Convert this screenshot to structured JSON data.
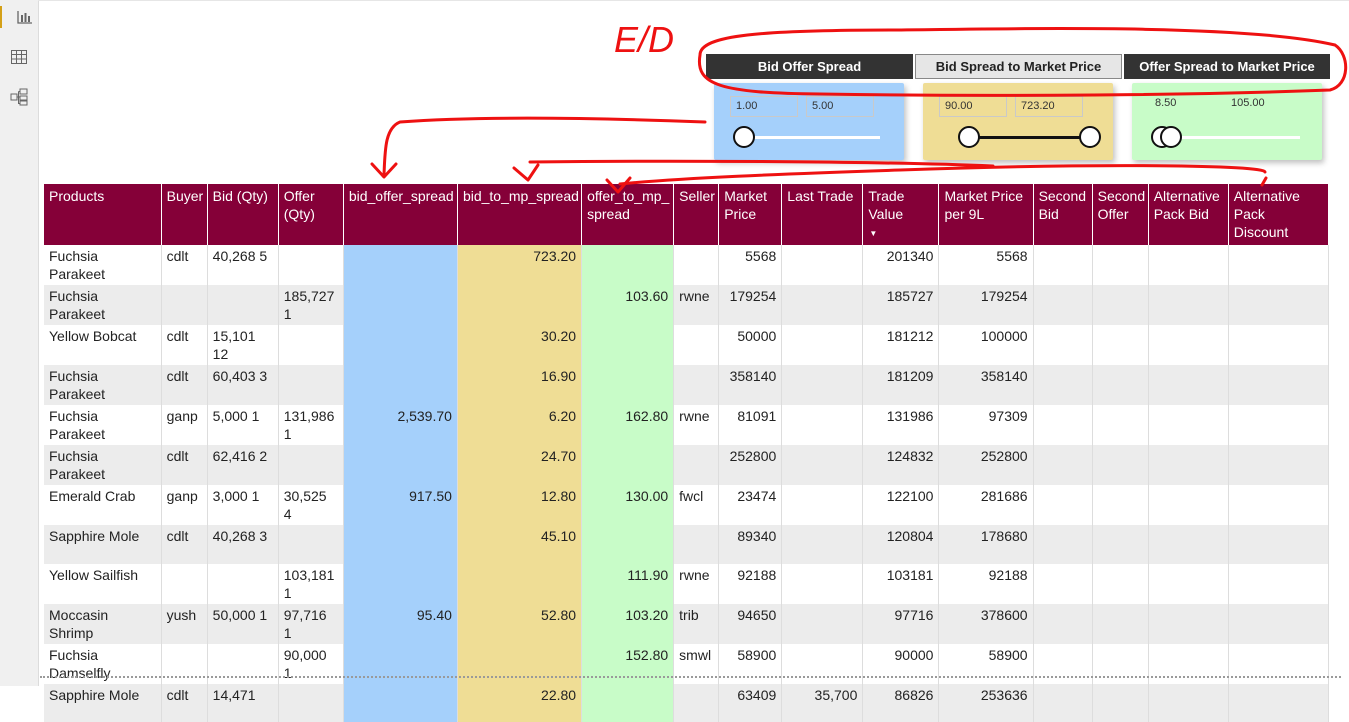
{
  "nav": {
    "items": [
      {
        "name": "report-view-icon"
      },
      {
        "name": "data-view-icon"
      },
      {
        "name": "model-view-icon"
      }
    ]
  },
  "annotation": {
    "text": "E/D"
  },
  "buttons": [
    {
      "label": "Bid Offer Spread",
      "style": "dark"
    },
    {
      "label": "Bid Spread to Market Price",
      "style": "light"
    },
    {
      "label": "Offer Spread to Market Price",
      "style": "dark"
    }
  ],
  "slicers": [
    {
      "min": "1.00",
      "max": "5.00",
      "color": "#a5d0fb"
    },
    {
      "min": "90.00",
      "max": "723.20",
      "color": "#efdd95"
    },
    {
      "min": "8.50",
      "max": "105.00",
      "color": "#c8fcc8"
    }
  ],
  "table": {
    "columns": [
      "Products",
      "Buyer",
      "Bid (Qty)",
      "Offer (Qty)",
      "bid_offer_spread",
      "bid_to_mp_spread",
      "offer_to_mp_ spread",
      "Seller",
      "Market Price",
      "Last Trade",
      "Trade Value",
      "Market Price per 9L",
      "Second Bid",
      "Second Offer",
      "Alternative Pack Bid",
      "Alternative Pack Discount"
    ],
    "sort_column": "Trade Value",
    "rows": [
      [
        "Fuchsia Parakeet",
        "cdlt",
        "40,268 5",
        "",
        "",
        "723.20",
        "",
        "",
        "5568",
        "",
        "201340",
        "5568",
        "",
        "",
        "",
        ""
      ],
      [
        "Fuchsia Parakeet",
        "",
        "",
        "185,727 1",
        "",
        "",
        "103.60",
        "rwne",
        "179254",
        "",
        "185727",
        "179254",
        "",
        "",
        "",
        ""
      ],
      [
        "Yellow Bobcat",
        "cdlt",
        "15,101 12",
        "",
        "",
        "30.20",
        "",
        "",
        "50000",
        "",
        "181212",
        "100000",
        "",
        "",
        "",
        ""
      ],
      [
        "Fuchsia Parakeet",
        "cdlt",
        "60,403 3",
        "",
        "",
        "16.90",
        "",
        "",
        "358140",
        "",
        "181209",
        "358140",
        "",
        "",
        "",
        ""
      ],
      [
        "Fuchsia Parakeet",
        "ganp",
        "5,000 1",
        "131,986 1",
        "2,539.70",
        "6.20",
        "162.80",
        "rwne",
        "81091",
        "",
        "131986",
        "97309",
        "",
        "",
        "",
        ""
      ],
      [
        "Fuchsia Parakeet",
        "cdlt",
        "62,416 2",
        "",
        "",
        "24.70",
        "",
        "",
        "252800",
        "",
        "124832",
        "252800",
        "",
        "",
        "",
        ""
      ],
      [
        "Emerald Crab",
        "ganp",
        "3,000 1",
        "30,525 4",
        "917.50",
        "12.80",
        "130.00",
        "fwcl",
        "23474",
        "",
        "122100",
        "281686",
        "",
        "",
        "",
        ""
      ],
      [
        "Sapphire Mole",
        "cdlt",
        "40,268 3",
        "",
        "",
        "45.10",
        "",
        "",
        "89340",
        "",
        "120804",
        "178680",
        "",
        "",
        "",
        ""
      ],
      [
        "Yellow Sailfish",
        "",
        "",
        "103,181 1",
        "",
        "",
        "111.90",
        "rwne",
        "92188",
        "",
        "103181",
        "92188",
        "",
        "",
        "",
        ""
      ],
      [
        "Moccasin Shrimp",
        "yush",
        "50,000 1",
        "97,716 1",
        "95.40",
        "52.80",
        "103.20",
        "trib",
        "94650",
        "",
        "97716",
        "378600",
        "",
        "",
        "",
        ""
      ],
      [
        "Fuchsia Damselfly",
        "",
        "",
        "90,000 1",
        "",
        "",
        "152.80",
        "smwl",
        "58900",
        "",
        "90000",
        "58900",
        "",
        "",
        "",
        ""
      ],
      [
        "Sapphire Mole",
        "cdlt",
        "14,471",
        "",
        "",
        "22.80",
        "",
        "",
        "63409",
        "35,700",
        "86826",
        "253636",
        "",
        "",
        "",
        ""
      ]
    ]
  }
}
